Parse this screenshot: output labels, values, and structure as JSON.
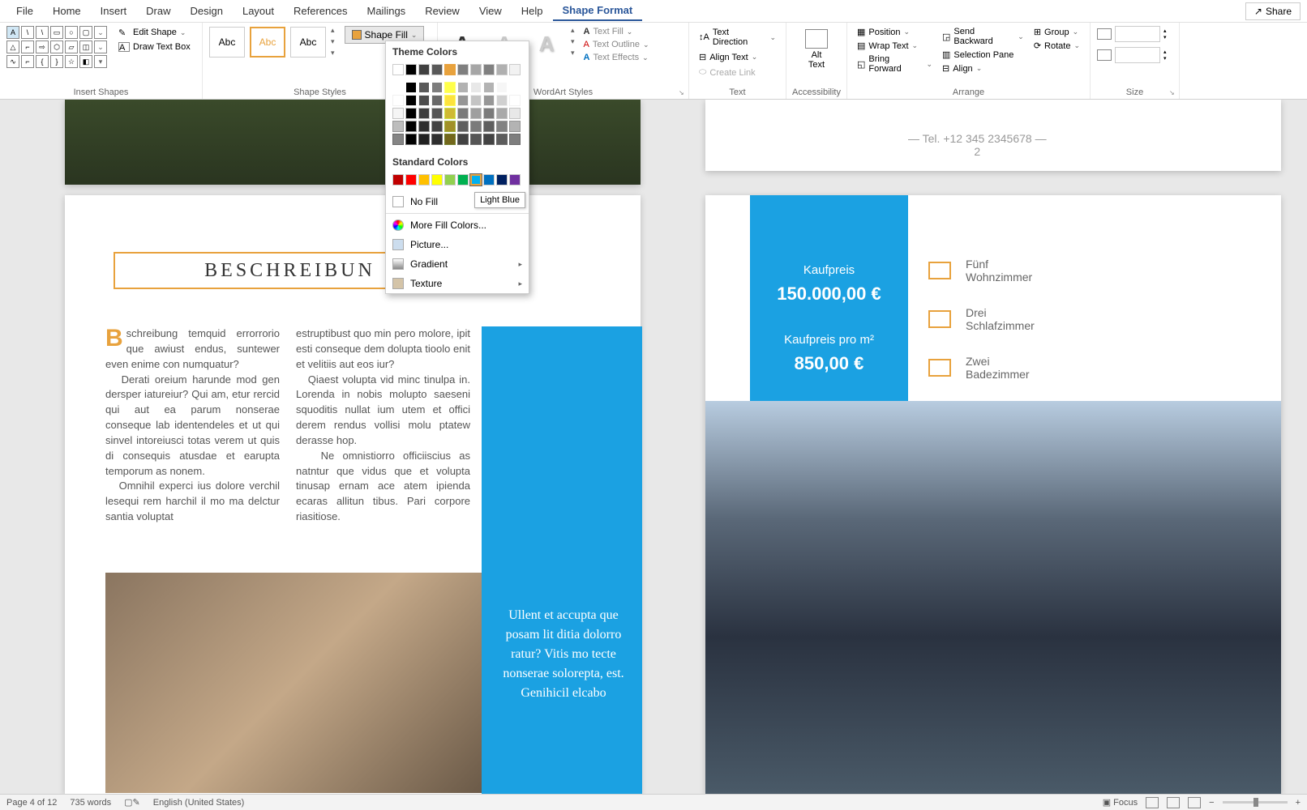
{
  "tabs": [
    "File",
    "Home",
    "Insert",
    "Draw",
    "Design",
    "Layout",
    "References",
    "Mailings",
    "Review",
    "View",
    "Help",
    "Shape Format"
  ],
  "active_tab": "Shape Format",
  "share": "Share",
  "ribbon": {
    "insert_shapes": {
      "label": "Insert Shapes",
      "edit_shape": "Edit Shape",
      "text_box": "Draw Text Box"
    },
    "shape_styles": {
      "label": "Shape Styles",
      "sample": "Abc",
      "fill": "Shape Fill"
    },
    "wordart": {
      "label": "WordArt Styles",
      "text_fill": "Text Fill",
      "text_outline": "Text Outline",
      "text_effects": "Text Effects"
    },
    "text": {
      "label": "Text",
      "direction": "Text Direction",
      "align": "Align Text",
      "link": "Create Link"
    },
    "accessibility": {
      "label": "Accessibility",
      "alt": "Alt Text"
    },
    "arrange": {
      "label": "Arrange",
      "position": "Position",
      "wrap": "Wrap Text",
      "forward": "Bring Forward",
      "backward": "Send Backward",
      "selection": "Selection Pane",
      "align": "Align",
      "group": "Group",
      "rotate": "Rotate"
    },
    "size": {
      "label": "Size"
    }
  },
  "dropdown": {
    "theme": "Theme Colors",
    "standard": "Standard Colors",
    "nofill": "No Fill",
    "tooltip": "Light Blue",
    "more": "More Fill Colors...",
    "picture": "Picture...",
    "gradient": "Gradient",
    "texture": "Texture",
    "theme_row": [
      "#ffffff",
      "#000000",
      "#404040",
      "#595959",
      "#E8A23D",
      "#7f7f7f",
      "#a6a6a6",
      "#808080",
      "#b0b0b0",
      "#f2f2f2"
    ],
    "standard_row": [
      "#c00000",
      "#ff0000",
      "#ffc000",
      "#ffff00",
      "#92d050",
      "#00b050",
      "#00b0f0",
      "#0070c0",
      "#002060",
      "#7030a0"
    ]
  },
  "doc": {
    "beschreibung": "BESCHREIBUN",
    "col1": "schreibung temquid errorrorio que awiust endus, suntewer even enime con numquatur?\n   Derati oreium harunde mod gen dersper iatureiur? Qui am, etur rercid qui aut ea parum nonserae conseque lab identendeles et ut qui sinvel intoreiusci totas verem ut quis di consequis atusdae et earupta temporum as nonem.\n   Omnihil experci ius dolore verchil lesequi rem harchil il mo ma delctur santia voluptat",
    "col2": "estruptibust quo min pero molore, ipit esti conseque dem dolupta tioolo enit et velitiis aut eos iur?\n   Qiaest volupta vid minc tinulpa in. Lorenda in nobis molupto saeseni squoditis nullat ium utem et offici derem rendus vollisi molu ptatew derasse hop.\n   Ne omnistiorro officiiscius as natntur que vidus que et volupta tinusap ernam ace atem ipienda ecaras allitun tibus. Pari corpore riasitiose.",
    "quote": "Ullent et accupta que posam lit ditia dolorro ratur? Vitis mo tecte nonserae solorepta, est. Genihicil elcabo",
    "tel": "— Tel. +12 345 2345678 —",
    "tel2": "2",
    "price1_label": "Kaufpreis",
    "price1": "150.000,00 €",
    "price2_label": "Kaufpreis pro m²",
    "price2": "850,00 €",
    "feat1a": "Fünf",
    "feat1b": "Wohnzimmer",
    "feat2a": "Drei",
    "feat2b": "Schlafzimmer",
    "feat3a": "Zwei",
    "feat3b": "Badezimmer"
  },
  "status": {
    "page": "Page 4 of 12",
    "words": "735 words",
    "lang": "English (United States)",
    "focus": "Focus"
  }
}
